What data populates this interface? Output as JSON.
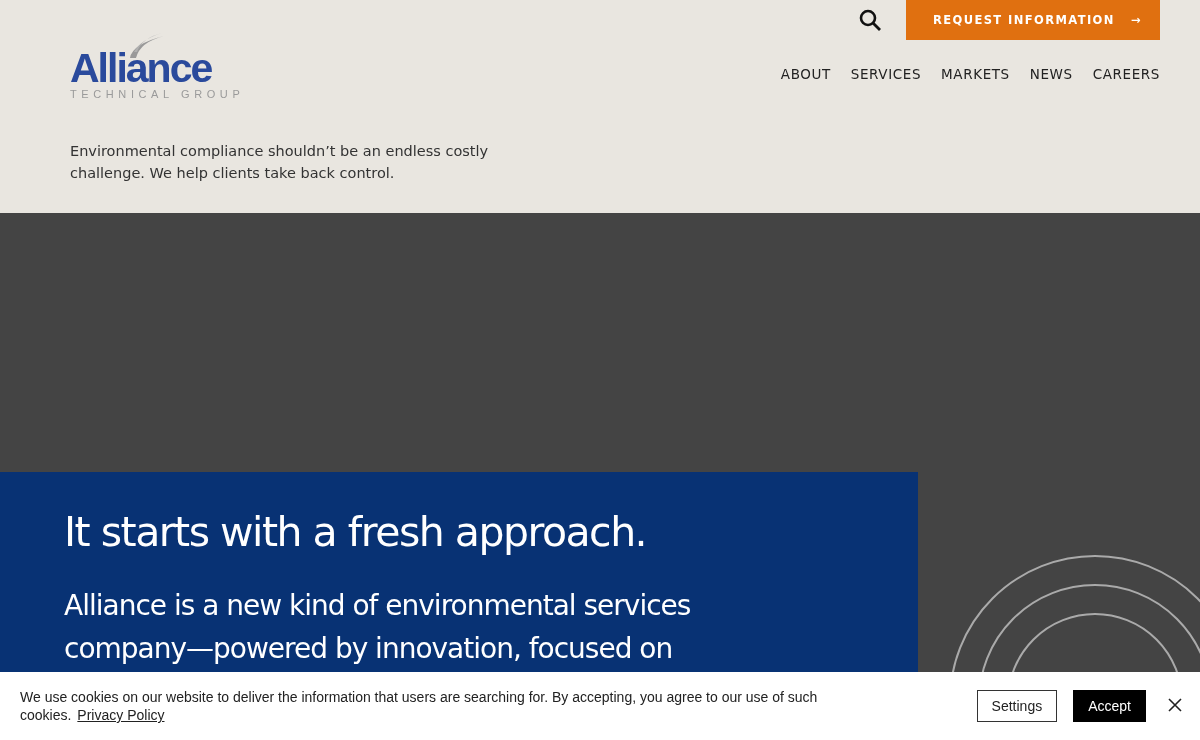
{
  "header": {
    "logo": {
      "name": "Alliance",
      "tagline": "TECHNICAL GROUP"
    },
    "cta": {
      "label": "REQUEST INFORMATION",
      "arrow": "→"
    },
    "nav": [
      {
        "label": "ABOUT"
      },
      {
        "label": "SERVICES"
      },
      {
        "label": "MARKETS"
      },
      {
        "label": "NEWS"
      },
      {
        "label": "CAREERS"
      }
    ],
    "intro": "Environmental compliance shouldn’t be an endless costly challenge. We help clients take back control."
  },
  "hero": {
    "title": "It starts with a fresh approach.",
    "lines": [
      "Alliance is a new kind of environmental services",
      "company—powered by innovation, focused on"
    ]
  },
  "cookie_bar": {
    "text": "We use cookies on our website to deliver the information that users are searching for. By accepting, you agree to our use of such cookies.",
    "link": "Privacy Policy",
    "buttons": [
      {
        "label": "Settings",
        "kind": "outline"
      },
      {
        "label": "Accept",
        "kind": "solid"
      }
    ]
  }
}
